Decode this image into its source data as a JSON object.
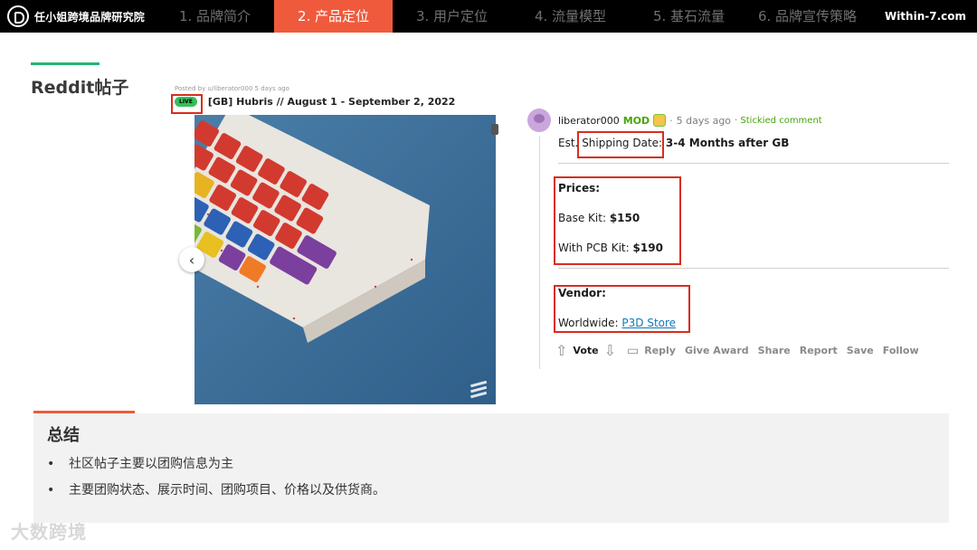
{
  "header": {
    "brand": "任小姐跨境品牌研究院",
    "tabs": [
      {
        "label": "1. 品牌简介",
        "active": false
      },
      {
        "label": "2. 产品定位",
        "active": true
      },
      {
        "label": "3. 用户定位",
        "active": false
      },
      {
        "label": "4. 流量模型",
        "active": false
      },
      {
        "label": "5. 基石流量",
        "active": false
      },
      {
        "label": "6. 品牌宣传策略",
        "active": false
      }
    ],
    "site": "Within-7.com"
  },
  "section_title": "Reddit帖子",
  "post": {
    "posted_by": "Posted by u/liberator000 5 days ago",
    "badge": "LIVE",
    "title": "[GB] Hubris // August 1 - September 2, 2022"
  },
  "comment": {
    "user": "liberator000",
    "mod": "MOD",
    "sep": "·",
    "time": "5 days ago",
    "sticky": "· Stickied comment",
    "est": "Est.",
    "shipping_label": "Shipping Date:",
    "shipping_value": "3-4 Months after GB",
    "prices_label": "Prices:",
    "base_label": "Base Kit:",
    "base_value": "$150",
    "pcb_label": "With PCB Kit:",
    "pcb_value": "$190",
    "vendor_label": "Vendor:",
    "worldwide_label": "Worldwide:",
    "vendor_link": "P3D Store"
  },
  "actions": [
    "Vote",
    "Reply",
    "Give Award",
    "Share",
    "Report",
    "Save",
    "Follow"
  ],
  "summary": {
    "title": "总结",
    "bullets": [
      "社区帖子主要以团购信息为主",
      "主要团购状态、展示时间、团购项目、价格以及供货商。"
    ]
  },
  "watermark": "大数跨境",
  "colors": {
    "accent_orange": "#f05a3c",
    "accent_green": "#22b573",
    "highlight_red": "#d92d20",
    "link_blue": "#0e78bd",
    "mod_green": "#46a508"
  }
}
